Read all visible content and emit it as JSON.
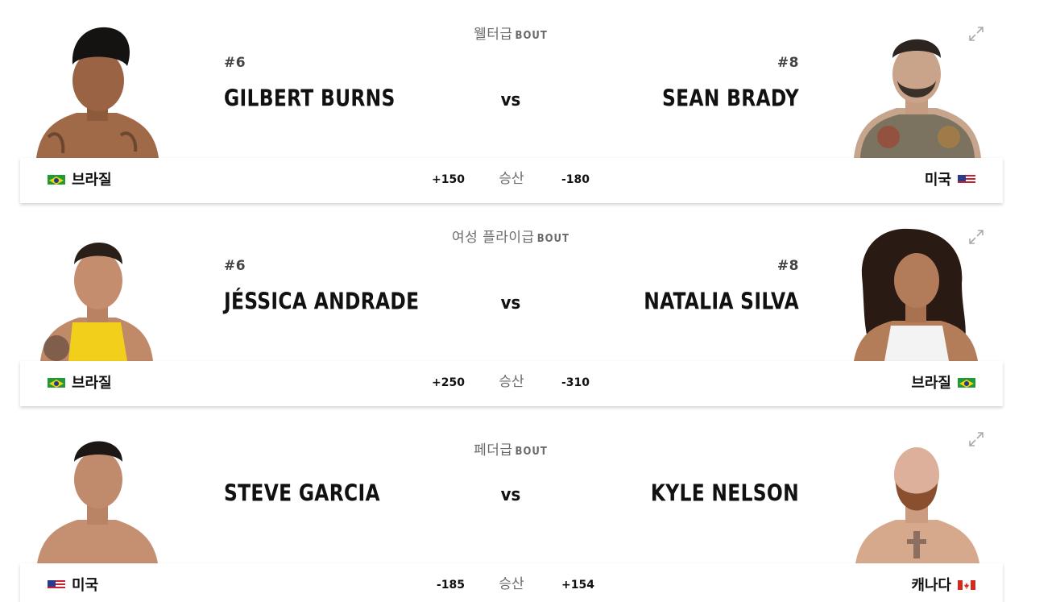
{
  "bouts": [
    {
      "weight_class": "웰터급",
      "bout_word": "BOUT",
      "vs_label": "vs",
      "winner_label": "승산",
      "left": {
        "rank": "#6",
        "name": "GILBERT BURNS",
        "country": "브라질",
        "flag": "brazil-flag-icon",
        "odds": "+150"
      },
      "right": {
        "rank": "#8",
        "name": "SEAN BRADY",
        "country": "미국",
        "flag": "usa-flag-icon",
        "odds": "-180"
      }
    },
    {
      "weight_class": "여성 플라이급",
      "bout_word": "BOUT",
      "vs_label": "vs",
      "winner_label": "승산",
      "left": {
        "rank": "#6",
        "name": "JÉSSICA ANDRADE",
        "country": "브라질",
        "flag": "brazil-flag-icon",
        "odds": "+250"
      },
      "right": {
        "rank": "#8",
        "name": "NATALIA SILVA",
        "country": "브라질",
        "flag": "brazil-flag-icon",
        "odds": "-310"
      }
    },
    {
      "weight_class": "페더급",
      "bout_word": "BOUT",
      "vs_label": "vs",
      "winner_label": "승산",
      "left": {
        "rank": "",
        "name": "STEVE GARCIA",
        "country": "미국",
        "flag": "usa-flag-icon",
        "odds": "-185"
      },
      "right": {
        "rank": "",
        "name": "KYLE NELSON",
        "country": "캐나다",
        "flag": "canada-flag-icon",
        "odds": "+154"
      }
    }
  ]
}
